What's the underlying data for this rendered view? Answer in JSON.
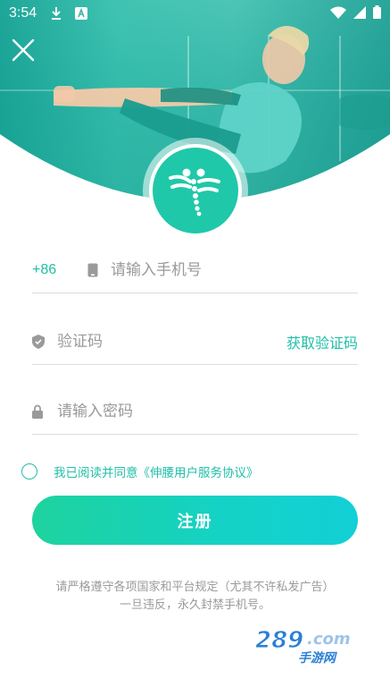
{
  "status_bar": {
    "time": "3:54",
    "icons": [
      "download-icon",
      "a-badge-icon",
      "wifi-icon",
      "signal-icon",
      "battery-icon"
    ]
  },
  "hero": {
    "close_icon": "close-icon",
    "logo_icon": "dragonfly-logo-icon"
  },
  "form": {
    "country_code": "+86",
    "phone_placeholder": "请输入手机号",
    "code_placeholder": "验证码",
    "get_code_label": "获取验证码",
    "password_placeholder": "请输入密码"
  },
  "agreement": {
    "text": "我已阅读并同意《伸腰用户服务协议》"
  },
  "register_label": "注册",
  "notice": {
    "line1": "请严格遵守各项国家和平台规定（尤其不许私发广告）",
    "line2": "一旦违反，永久封禁手机号。"
  },
  "watermark": {
    "text": "289.com",
    "subtext": "手游网"
  },
  "colors": {
    "accent": "#1fbfa8",
    "button_start": "#1ed39e",
    "button_end": "#12d0d6"
  }
}
